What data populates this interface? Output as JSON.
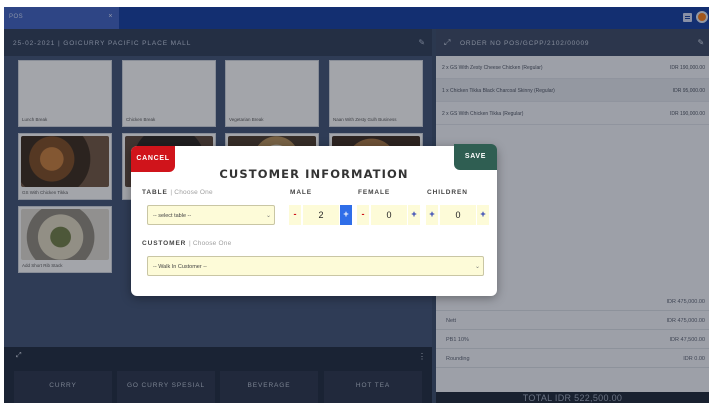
{
  "topbar": {
    "tab_title": "POS",
    "tab_close": "×"
  },
  "left": {
    "header": "25-02-2021 | GOICURRY PACIFIC PLACE MALL",
    "products": [
      {
        "name": "Lunch Break",
        "image": ""
      },
      {
        "name": "Chicken Break",
        "image": ""
      },
      {
        "name": "Vegetarian Break",
        "image": ""
      },
      {
        "name": "Naan With Zesty Gulh Business",
        "image": ""
      },
      {
        "name": "GS With Chicken Tikka",
        "image": "food1"
      },
      {
        "name": "",
        "image": "food2"
      },
      {
        "name": "",
        "image": "food3"
      },
      {
        "name": "",
        "image": "food4"
      },
      {
        "name": "Add Short Rib Stack",
        "image": "food5"
      }
    ],
    "categories": [
      "CURRY",
      "GO CURRY SPESIAL",
      "BEVERAGE",
      "HOT TEA"
    ]
  },
  "right": {
    "order_header": "ORDER NO POS/GCPP/2102/00009",
    "items": [
      {
        "name": "2 x GS With Zesty Cheese Chicken (Regular)",
        "price": "IDR 190,000.00"
      },
      {
        "name": "1 x Chicken Tikka Black Charcoal Skinny (Regular)",
        "price": "IDR 95,000.00"
      },
      {
        "name": "2 x GS With Chicken Tikka (Regular)",
        "price": "IDR 190,000.00"
      }
    ],
    "subtotal": "IDR 475,000.00",
    "nett_label": "Nett",
    "nett_value": "IDR 475,000.00",
    "pb1_label": "PB1 10%",
    "pb1_value": "IDR 47,500.00",
    "rounding_label": "Rounding",
    "rounding_value": "IDR 0.00",
    "total": "TOTAL IDR 522,500.00"
  },
  "modal": {
    "cancel": "CANCEL",
    "save": "SAVE",
    "title": "CUSTOMER INFORMATION",
    "table_label": "TABLE",
    "table_hint": "| Choose One",
    "table_value": "-- select table --",
    "male_label": "MALE",
    "male_value": "2",
    "female_label": "FEMALE",
    "female_value": "0",
    "children_label": "CHILDREN",
    "children_value": "0",
    "customer_label": "CUSTOMER",
    "customer_hint": "| Choose One",
    "customer_value": "-- Walk In Customer --",
    "minus": "-",
    "plus": "+"
  }
}
